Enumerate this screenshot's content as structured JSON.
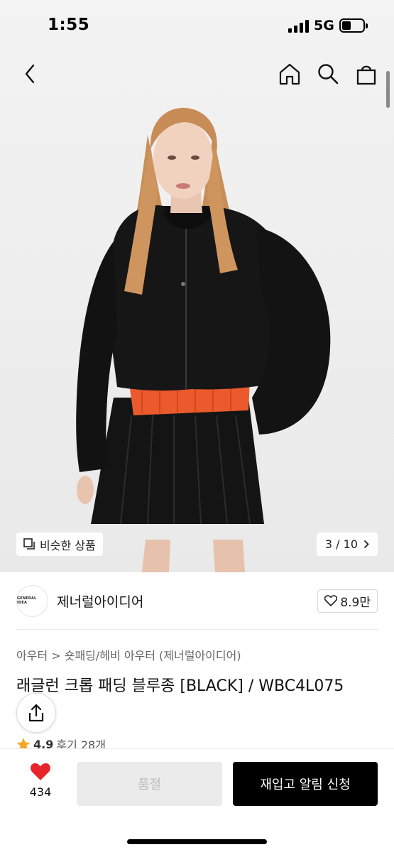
{
  "status_bar": {
    "time": "1:55",
    "network": "5G"
  },
  "gallery": {
    "similar_label": "비슷한 상품",
    "counter": "3 / 10"
  },
  "brand": {
    "logo_text": "GENERAL IDEA",
    "name": "제너럴아이디어",
    "likes": "8.9만"
  },
  "product": {
    "breadcrumb": "아우터 > 숏패딩/헤비 아우터 (제너럴아이디어)",
    "title": "래글런 크롭 패딩 블루종 [BLACK] / WBC4L075",
    "rating": "4.9",
    "reviews": "후기 28개"
  },
  "bottom_bar": {
    "wish_count": "434",
    "sold_out_label": "품절",
    "restock_label": "재입고 알림 신청"
  },
  "colors": {
    "accent": "#000000",
    "heart": "#e8232b",
    "star": "#f5a623"
  },
  "icons": [
    "back-icon",
    "home-icon",
    "search-icon",
    "bag-icon",
    "similar-icon",
    "chevron-right-icon",
    "heart-outline-icon",
    "share-icon",
    "star-icon",
    "heart-filled-icon"
  ]
}
